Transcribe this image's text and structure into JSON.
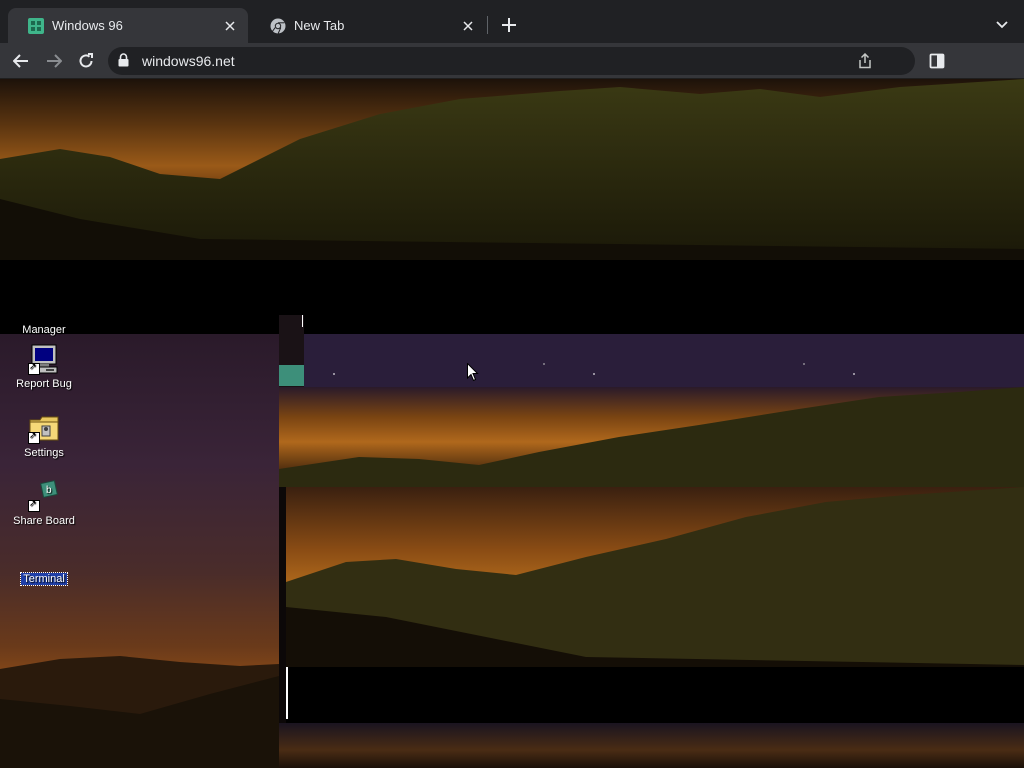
{
  "browser": {
    "tabs": [
      {
        "title": "Windows 96",
        "active": true,
        "icon": "windows96-favicon"
      },
      {
        "title": "New Tab",
        "active": false,
        "icon": "chrome-icon"
      }
    ],
    "address": {
      "url": "windows96.net"
    }
  },
  "desktop": {
    "icons": [
      {
        "label": "Manager",
        "icon": "manager-icon"
      },
      {
        "label": "Report Bug",
        "icon": "computer-icon"
      },
      {
        "label": "Settings",
        "icon": "settings-folder-icon"
      },
      {
        "label": "Share Board",
        "icon": "share-board-icon"
      },
      {
        "label": "Terminal",
        "icon": "terminal-icon",
        "selected": true
      }
    ]
  },
  "colors": {
    "tabstrip": "#202124",
    "toolbar": "#35363a",
    "selection": "#1f3fa8",
    "accent_teal": "#3d8f7a"
  }
}
